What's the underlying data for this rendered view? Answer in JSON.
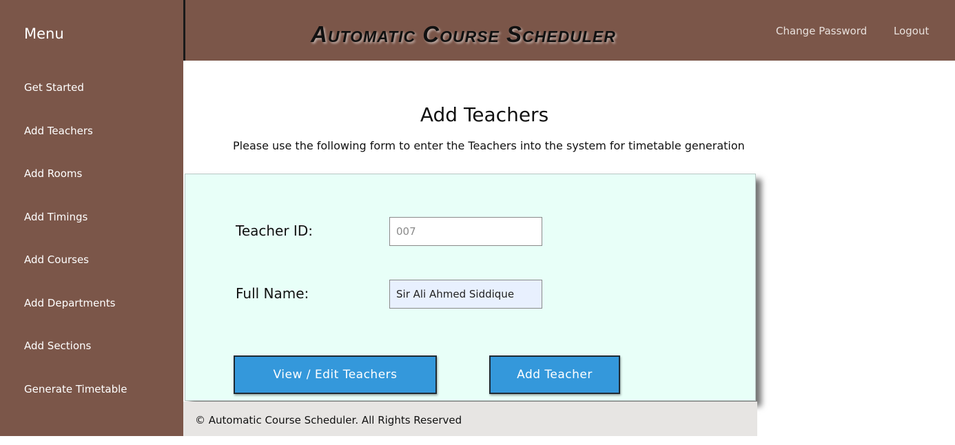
{
  "sidebar": {
    "title": "Menu",
    "items": [
      {
        "label": "Get Started"
      },
      {
        "label": "Add Teachers"
      },
      {
        "label": "Add Rooms"
      },
      {
        "label": "Add Timings"
      },
      {
        "label": "Add Courses"
      },
      {
        "label": "Add Departments"
      },
      {
        "label": "Add Sections"
      },
      {
        "label": "Generate Timetable"
      }
    ]
  },
  "header": {
    "title": "Automatic Course Scheduler",
    "change_password": "Change Password",
    "logout": "Logout"
  },
  "main": {
    "heading": "Add Teachers",
    "description": "Please use the following form to enter the Teachers into the system for timetable generation"
  },
  "form": {
    "teacher_id": {
      "label": "Teacher ID:",
      "placeholder": "007",
      "value": ""
    },
    "full_name": {
      "label": "Full Name:",
      "placeholder": "",
      "value": "Sir Ali Ahmed Siddique"
    },
    "view_edit_button": "View / Edit Teachers",
    "add_button": "Add Teacher"
  },
  "footer": {
    "text": "© Automatic Course Scheduler. All Rights Reserved"
  },
  "colors": {
    "brand_brown": "#7b5649",
    "panel_mint": "#e8fff8",
    "button_blue": "#3498db",
    "footer_gray": "#e7e5e3"
  }
}
